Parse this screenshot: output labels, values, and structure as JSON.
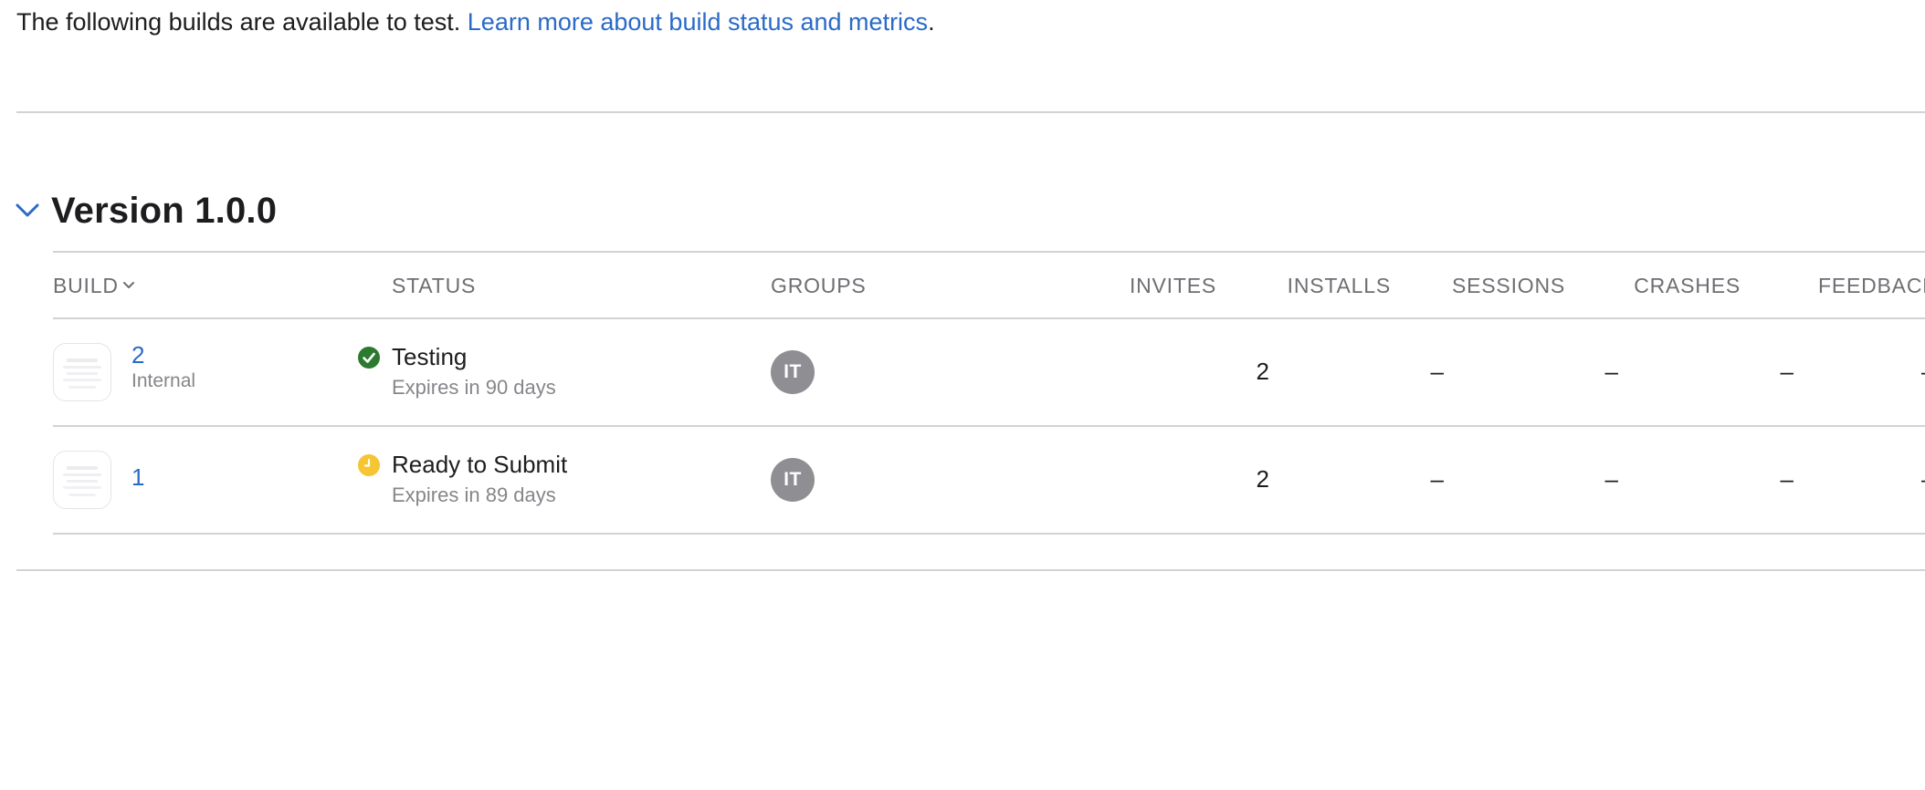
{
  "intro": {
    "text": "The following builds are available to test. ",
    "link": "Learn more about build status and metrics",
    "suffix": "."
  },
  "version": {
    "title": "Version 1.0.0"
  },
  "columns": {
    "build": "BUILD",
    "status": "STATUS",
    "groups": "GROUPS",
    "invites": "INVITES",
    "installs": "INSTALLS",
    "sessions": "SESSIONS",
    "crashes": "CRASHES",
    "feedback": "FEEDBACK"
  },
  "builds": [
    {
      "number": "2",
      "subtitle": "Internal",
      "status": "Testing",
      "status_icon": "checkmark-circle-icon",
      "status_color": "#2c7a2e",
      "expires": "Expires in 90 days",
      "group_initials": "IT",
      "invites": "2",
      "installs": "–",
      "sessions": "–",
      "crashes": "–",
      "feedback": "–"
    },
    {
      "number": "1",
      "subtitle": "",
      "status": "Ready to Submit",
      "status_icon": "clock-circle-icon",
      "status_color": "#f5c533",
      "expires": "Expires in 89 days",
      "group_initials": "IT",
      "invites": "2",
      "installs": "–",
      "sessions": "–",
      "crashes": "–",
      "feedback": "–"
    }
  ],
  "colors": {
    "link": "#2a6ac8",
    "divider": "#d2d2d7",
    "avatar": "#8e8e93"
  }
}
